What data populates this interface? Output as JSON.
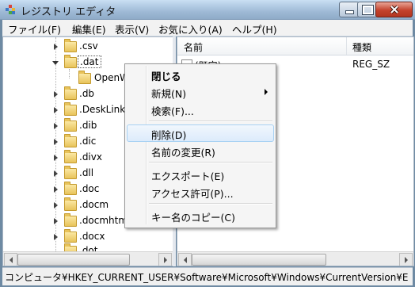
{
  "window": {
    "title": "レジストリ エディタ"
  },
  "menu": [
    "ファイル(F)",
    "編集(E)",
    "表示(V)",
    "お気に入り(A)",
    "ヘルプ(H)"
  ],
  "tree": {
    "items": [
      {
        "label": ".csv",
        "expanded": false
      },
      {
        "label": ".dat",
        "expanded": true
      },
      {
        "label": "OpenW",
        "expanded": false
      },
      {
        "label": ".db",
        "expanded": false
      },
      {
        "label": ".DeskLink",
        "expanded": false
      },
      {
        "label": ".dib",
        "expanded": false
      },
      {
        "label": ".dic",
        "expanded": false
      },
      {
        "label": ".divx",
        "expanded": false
      },
      {
        "label": ".dll",
        "expanded": false
      },
      {
        "label": ".doc",
        "expanded": false
      },
      {
        "label": ".docm",
        "expanded": false
      },
      {
        "label": ".docmhtm",
        "expanded": false
      },
      {
        "label": ".docx",
        "expanded": false
      },
      {
        "label": ".dot",
        "expanded": false
      }
    ]
  },
  "list": {
    "headers": [
      "名前",
      "種類"
    ],
    "rows": [
      {
        "name": "(既定)",
        "type": "REG_SZ"
      }
    ]
  },
  "context_menu": {
    "items": [
      "閉じる",
      "新規(N)",
      "検索(F)...",
      "削除(D)",
      "名前の変更(R)",
      "エクスポート(E)",
      "アクセス許可(P)...",
      "キー名のコピー(C)"
    ]
  },
  "status": {
    "path": "コンピュータ¥HKEY_CURRENT_USER¥Software¥Microsoft¥Windows¥CurrentVersion¥E"
  }
}
